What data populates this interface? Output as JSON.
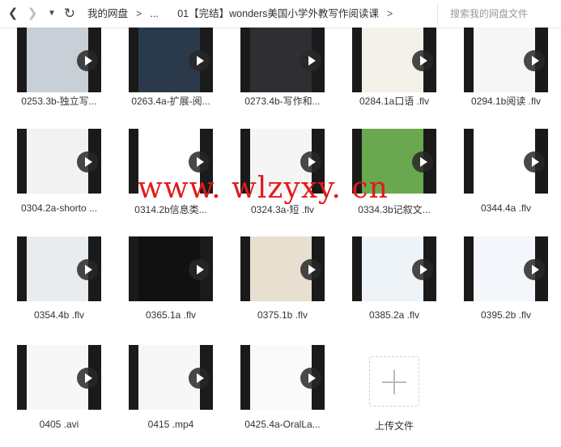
{
  "toolbar": {
    "back_icon": "chevron-left-icon",
    "forward_icon": "chevron-right-icon",
    "dropdown_icon": "caret-down-icon",
    "refresh_icon": "refresh-icon",
    "breadcrumb": [
      "我的网盘",
      "...",
      "01【完结】wonders美国小学外教写作阅读课"
    ],
    "search_placeholder": "搜索我的网盘文件"
  },
  "files": [
    {
      "name": "0253.3b-独立写...",
      "thumb": "#c9cfd6"
    },
    {
      "name": "0263.4a-扩展-阅...",
      "thumb": "#2a3a4a"
    },
    {
      "name": "0273.4b-写作和...",
      "thumb": "#2e2e33"
    },
    {
      "name": "0284.1a口语 .flv",
      "thumb": "#f4f1ea"
    },
    {
      "name": "0294.1b阅读 .flv",
      "thumb": "#f6f6f6"
    },
    {
      "name": "0304.2a-shorto ...",
      "thumb": "#f2f2f2"
    },
    {
      "name": "0314.2b信息类...",
      "thumb": "#ffffff"
    },
    {
      "name": "0324.3a-短 .flv",
      "thumb": "#f5f5f5"
    },
    {
      "name": "0334.3b记叙文...",
      "thumb": "#6aa84f"
    },
    {
      "name": "0344.4a .flv",
      "thumb": "#ffffff"
    },
    {
      "name": "0354.4b .flv",
      "thumb": "#e9ecef"
    },
    {
      "name": "0365.1a .flv",
      "thumb": "#111111"
    },
    {
      "name": "0375.1b .flv",
      "thumb": "#e8dfd0"
    },
    {
      "name": "0385.2a .flv",
      "thumb": "#eef3f8"
    },
    {
      "name": "0395.2b .flv",
      "thumb": "#f3f6fa"
    },
    {
      "name": "0405 .avi",
      "thumb": "#f7f7f7"
    },
    {
      "name": "0415 .mp4",
      "thumb": "#f7f7f7"
    },
    {
      "name": "0425.4a-OralLa...",
      "thumb": "#fafafa"
    }
  ],
  "upload": {
    "label": "上传文件",
    "icon": "plus-icon"
  },
  "watermark": "www. wlzyxy. cn",
  "colors": {
    "watermark": "#e21a1a",
    "accent": "#333333"
  }
}
